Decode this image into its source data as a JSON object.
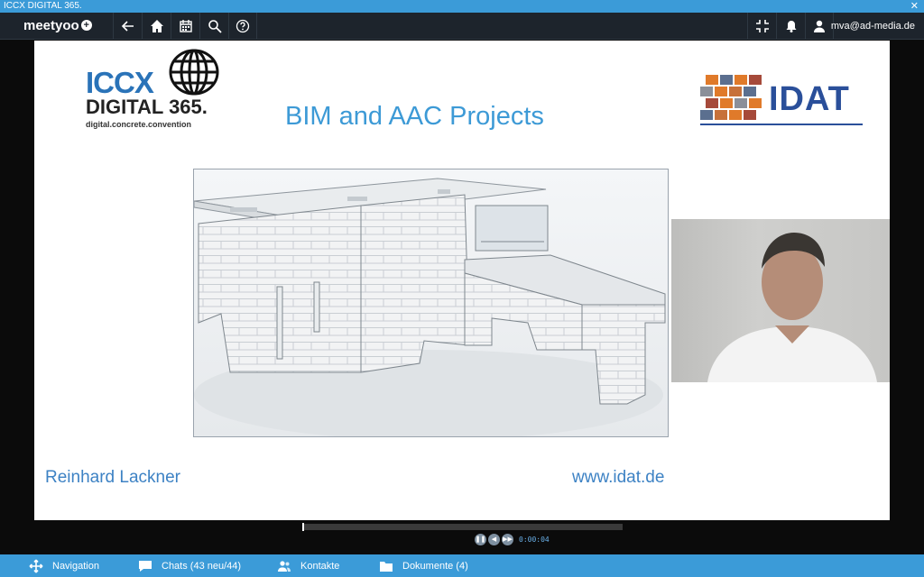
{
  "window": {
    "title": "ICCX DIGITAL 365.",
    "close_label": "✕"
  },
  "header": {
    "brand": "meetyoo",
    "user_email": "mva@ad-media.de"
  },
  "slide": {
    "iccx_line1": "ICCX",
    "iccx_line2": "DIGITAL 365.",
    "iccx_line3": "digital.concrete.convention",
    "title": "BIM and AAC Projects",
    "idat_logo": "IDAT",
    "presenter": "Reinhard Lackner",
    "website": "www.idat.de"
  },
  "player": {
    "time": "0:00:04"
  },
  "bottom_nav": {
    "navigation": "Navigation",
    "chats": "Chats (43 neu/44)",
    "contacts": "Kontakte",
    "documents": "Dokumente (4)"
  },
  "colors": {
    "accent": "#3b9bd8",
    "header_bg": "#1d242c",
    "slide_title": "#3d9ad6",
    "idat_blue": "#2a4f9a"
  }
}
